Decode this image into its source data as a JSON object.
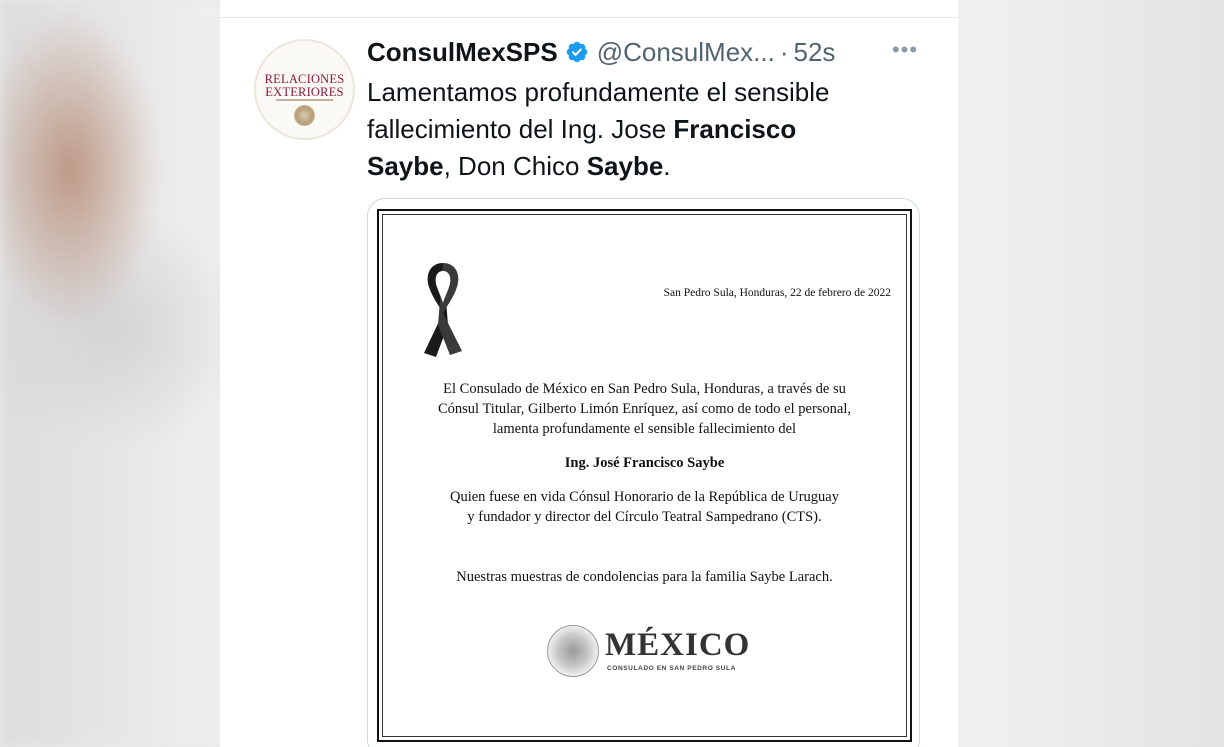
{
  "tweet": {
    "display_name": "ConsulMexSPS",
    "handle": "@ConsulMex...",
    "separator": "·",
    "time": "52s",
    "more_label": "•••",
    "avatar": {
      "line1": "RELACIONES",
      "line2": "EXTERIORES"
    },
    "text": {
      "t1": "Lamentamos profundamente el sensible fallecimiento del Ing. Jose ",
      "b1": "Francisco",
      "b2": "Saybe",
      "t2": ", Don Chico ",
      "b3": "Saybe",
      "t3": "."
    }
  },
  "card": {
    "date": "San Pedro Sula, Honduras, 22 de febrero de 2022",
    "para1_line1": "El Consulado de México en San Pedro Sula, Honduras, a través de su",
    "para1_line2": "Cónsul Titular, Gilberto Limón Enríquez, así como de todo el personal,",
    "para1_line3": "lamenta profundamente el sensible fallecimiento del",
    "name": "Ing. José Francisco Saybe",
    "para3_line1": "Quien fuese en vida Cónsul Honorario de la República de Uruguay",
    "para3_line2": "y fundador y director del Círculo Teatral Sampedrano (CTS).",
    "condolences": "Nuestras muestras de condolencias para la familia Saybe Larach.",
    "logo_word": "MÉXICO",
    "logo_sub": "CONSULADO EN SAN PEDRO SULA"
  },
  "colors": {
    "verified": "#1d9bf0",
    "secondary_text": "#536471",
    "primary_text": "#0f1419",
    "avatar_text": "#8a1b3d"
  },
  "icons": [
    "verified-badge-icon",
    "more-options-icon",
    "black-ribbon-icon",
    "mexico-seal-icon"
  ]
}
